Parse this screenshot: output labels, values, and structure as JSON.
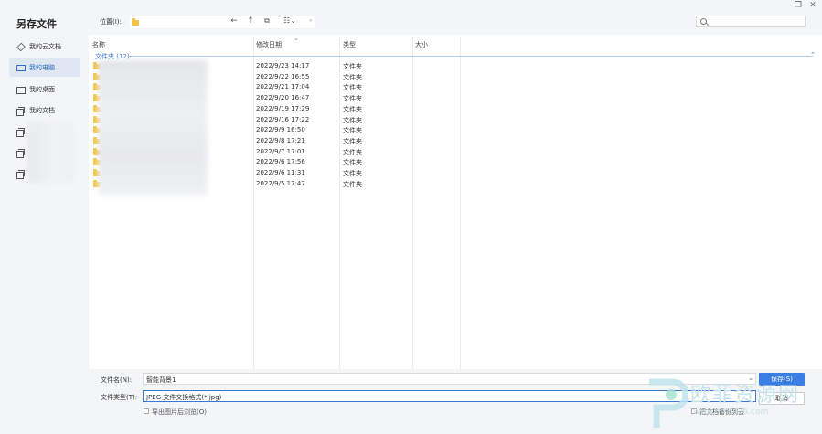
{
  "window": {
    "title": "另存文件",
    "restore_icon": "restore-icon",
    "close_icon": "close-icon"
  },
  "sidebar": {
    "items": [
      {
        "label": "我的云文档",
        "icon": "cloud-doc-icon",
        "active": false
      },
      {
        "label": "我的电脑",
        "icon": "computer-icon",
        "active": true
      },
      {
        "label": "我的桌面",
        "icon": "desktop-icon",
        "active": false
      },
      {
        "label": "我的文档",
        "icon": "documents-icon",
        "active": false
      },
      {
        "label": "",
        "icon": "folder-outline-icon",
        "active": false
      },
      {
        "label": "",
        "icon": "folder-outline-icon",
        "active": false
      },
      {
        "label": "",
        "icon": "folder-outline-icon",
        "active": false
      }
    ]
  },
  "toolbar": {
    "location_label": "位置(I):",
    "location_value": "",
    "back": "←",
    "up": "↑"
  },
  "columns": {
    "name": "名称",
    "modified": "修改日期",
    "type": "类型",
    "size": "大小"
  },
  "group": {
    "label": "文件夹 (12)",
    "toggle": "⌃"
  },
  "rows": [
    {
      "name": "",
      "modified": "2022/9/23 14:17",
      "type": "文件夹"
    },
    {
      "name": "",
      "modified": "2022/9/22 16:55",
      "type": "文件夹"
    },
    {
      "name": "",
      "modified": "2022/9/21 17:04",
      "type": "文件夹"
    },
    {
      "name": "",
      "modified": "2022/9/20 16:47",
      "type": "文件夹"
    },
    {
      "name": "",
      "modified": "2022/9/19 17:29",
      "type": "文件夹"
    },
    {
      "name": "",
      "modified": "2022/9/16 17:22",
      "type": "文件夹"
    },
    {
      "name": "",
      "modified": "2022/9/9 16:50",
      "type": "文件夹"
    },
    {
      "name": "",
      "modified": "2022/9/8 17:21",
      "type": "文件夹"
    },
    {
      "name": "",
      "modified": "2022/9/7 17:01",
      "type": "文件夹"
    },
    {
      "name": "",
      "modified": "2022/9/6 17:56",
      "type": "文件夹"
    },
    {
      "name": "",
      "modified": "2022/9/6 11:31",
      "type": "文件夹"
    },
    {
      "name": "",
      "modified": "2022/9/5 17:47",
      "type": "文件夹"
    }
  ],
  "footer": {
    "filename_label": "文件名(N):",
    "filename_value": "智能背景1",
    "filetype_label": "文件类型(T):",
    "filetype_value": "JPEG 文件交换格式(*.jpg)",
    "save_label": "保存(S)",
    "cancel_label": "取消",
    "export_preview_label": "导出图片后浏览(O)",
    "backup_label": "把文档备份到云"
  },
  "watermark": {
    "text": "欧菲资源网",
    "url": "www.office26.com"
  },
  "colors": {
    "accent": "#3a7de3",
    "folder": "#f4c242",
    "sidebar_active_bg": "#dfe7f3",
    "watermark": "#c6e3ea"
  }
}
